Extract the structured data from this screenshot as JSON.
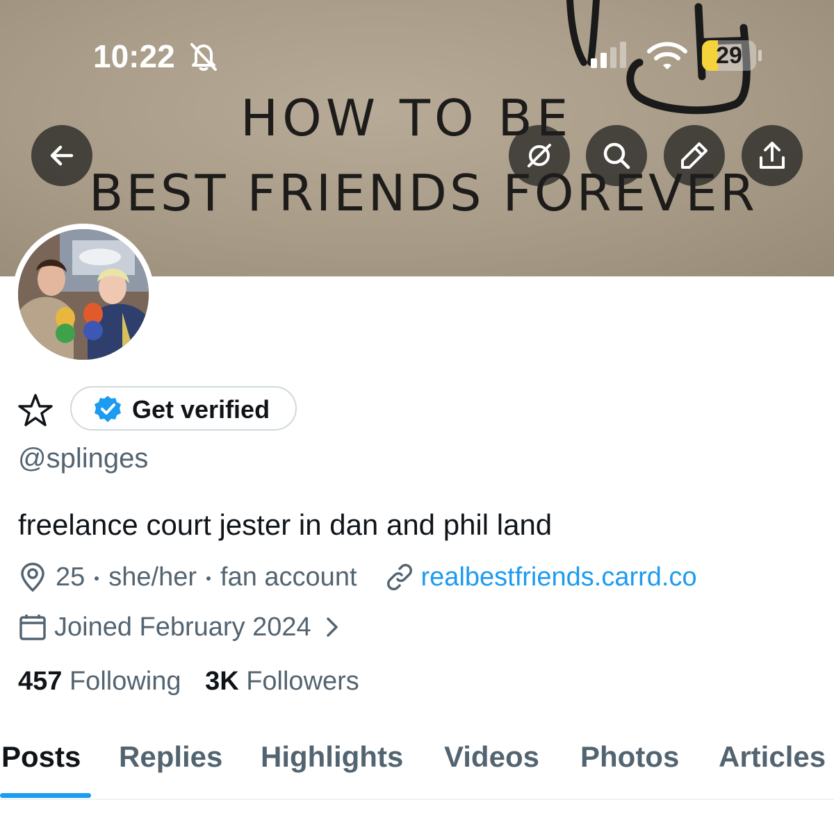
{
  "status_bar": {
    "time": "10:22",
    "battery": "29",
    "battery_level": 0.29
  },
  "banner": {
    "line1": "HOW TO BE",
    "line2": "BEST FRIENDS FOREVER"
  },
  "profile": {
    "get_verified_label": "Get verified",
    "handle": "@splinges",
    "bio": "freelance court jester in dan and phil land",
    "meta": [
      "25",
      "she/her",
      "fan account"
    ],
    "link": "realbestfriends.carrd.co",
    "joined": "Joined February 2024",
    "following_count": "457",
    "following_label": "Following",
    "followers_count": "3K",
    "followers_label": "Followers"
  },
  "tabs": [
    "Posts",
    "Replies",
    "Highlights",
    "Videos",
    "Photos",
    "Articles"
  ],
  "colors": {
    "accent": "#1d9bf0",
    "secondary_text": "#536471",
    "battery_low": "#f5d33b"
  },
  "icons": [
    "bell-slash-icon",
    "signal-icon",
    "wifi-icon",
    "back-arrow-icon",
    "grok-icon",
    "search-icon",
    "edit-icon",
    "share-icon",
    "star-icon",
    "verified-badge-icon",
    "location-icon",
    "link-icon",
    "calendar-icon",
    "chevron-right-icon"
  ]
}
